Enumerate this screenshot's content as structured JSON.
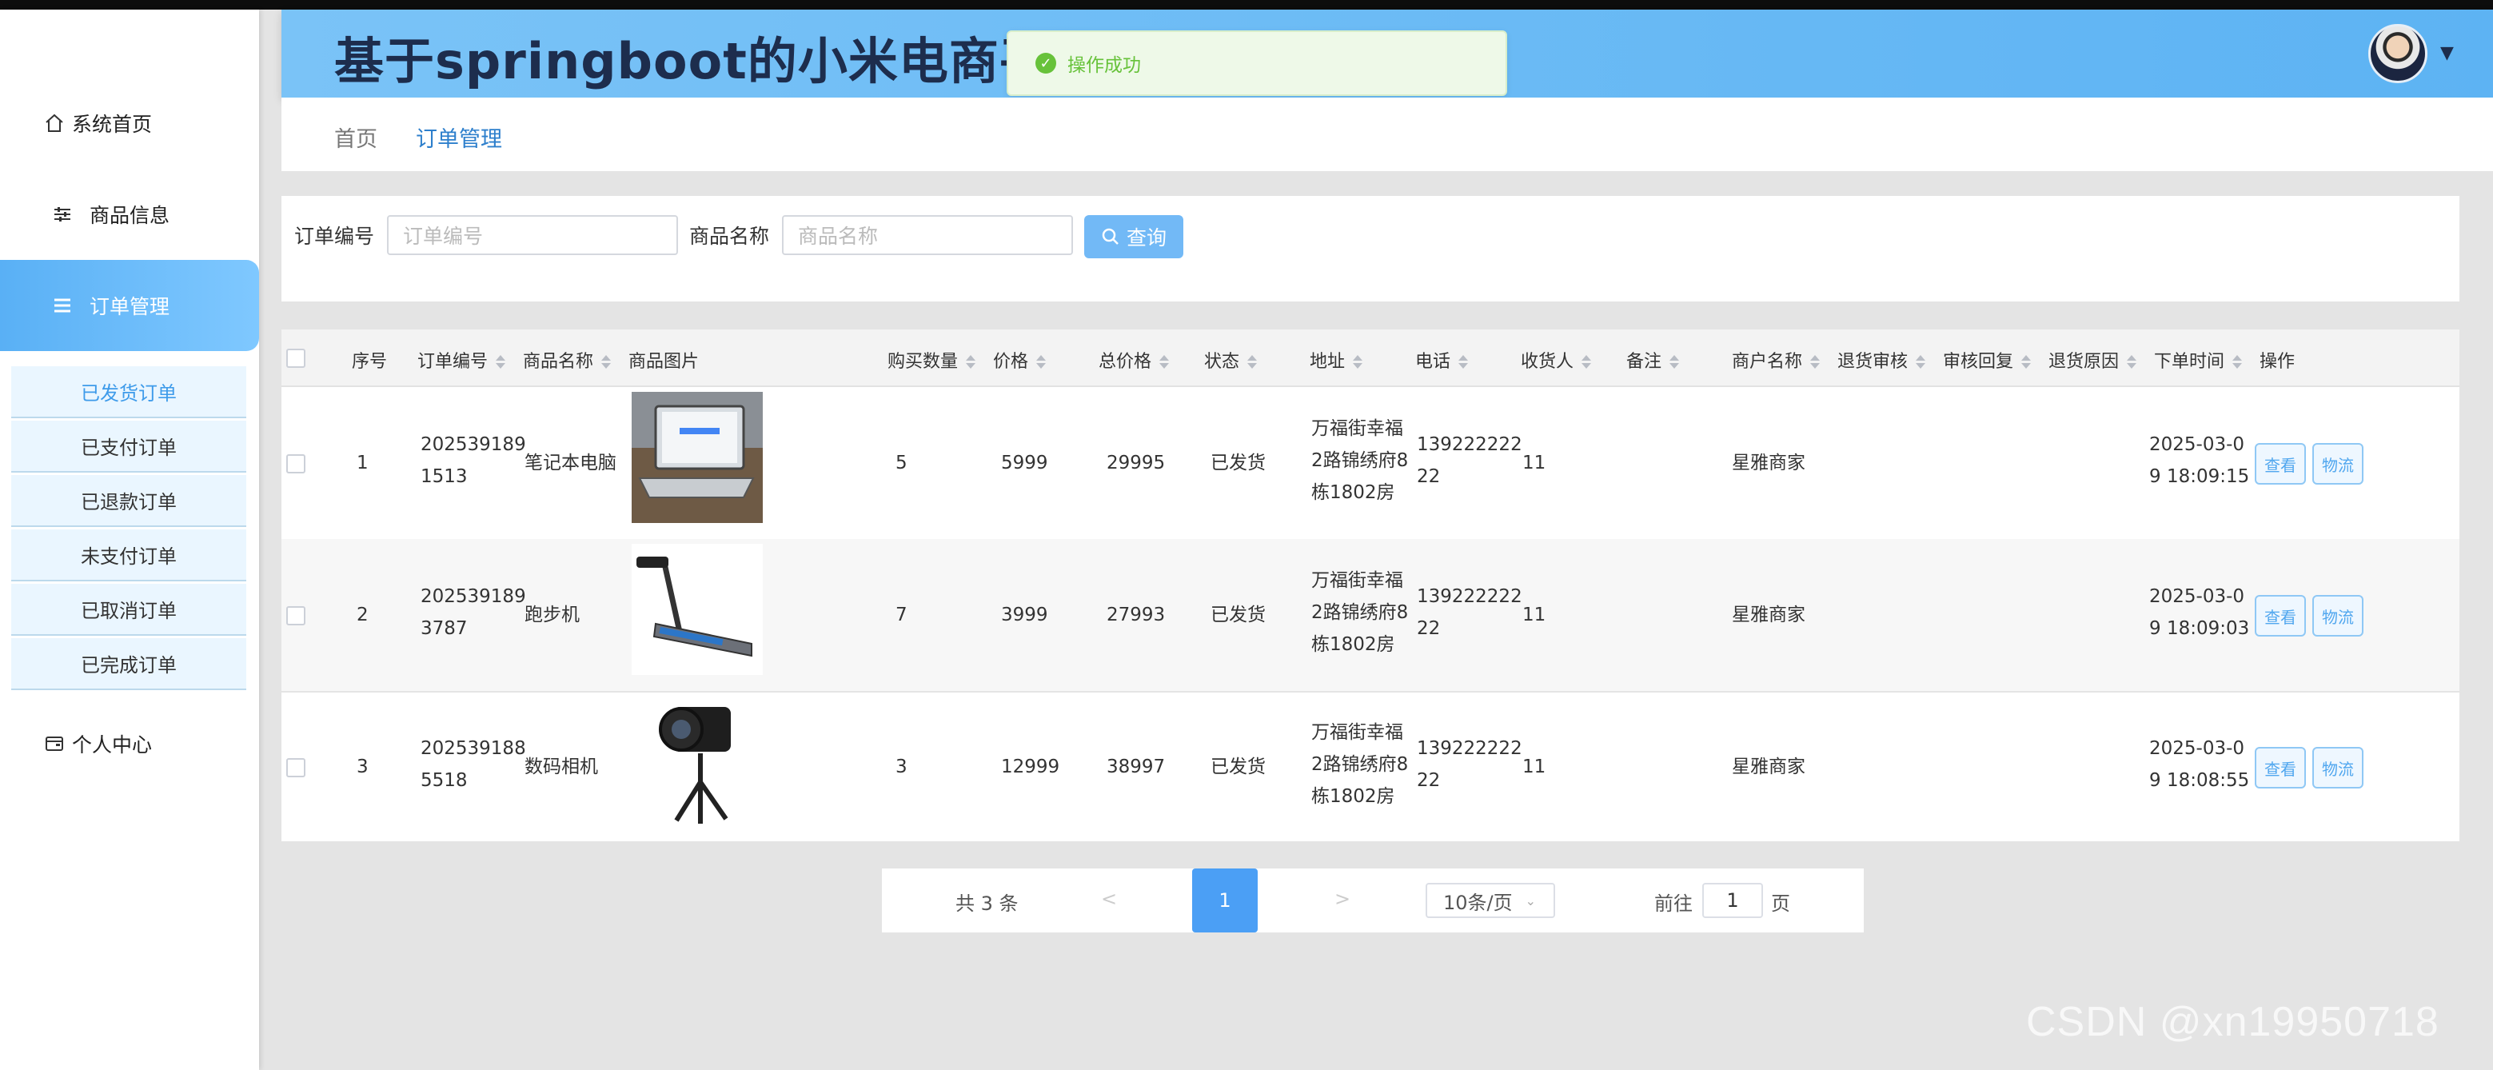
{
  "header": {
    "title": "基于springboot的小米电商平台系统设计与实现"
  },
  "toast": {
    "message": "操作成功"
  },
  "sidebar": {
    "items": [
      {
        "label": "系统首页",
        "icon": "home-icon"
      },
      {
        "label": "商品信息",
        "icon": "sliders-icon"
      },
      {
        "label": "订单管理",
        "icon": "list-icon"
      },
      {
        "label": "个人中心",
        "icon": "wallet-icon"
      }
    ],
    "sub_items": [
      "已发货订单",
      "已支付订单",
      "已退款订单",
      "未支付订单",
      "已取消订单",
      "已完成订单"
    ]
  },
  "breadcrumb": {
    "home": "首页",
    "current": "订单管理"
  },
  "search": {
    "order_no_label": "订单编号",
    "order_no_placeholder": "订单编号",
    "product_label": "商品名称",
    "product_placeholder": "商品名称",
    "query_label": "查询"
  },
  "table": {
    "headers": [
      "序号",
      "订单编号",
      "商品名称",
      "商品图片",
      "购买数量",
      "价格",
      "总价格",
      "状态",
      "地址",
      "电话",
      "收货人",
      "备注",
      "商户名称",
      "退货审核",
      "审核回复",
      "退货原因",
      "下单时间",
      "操作"
    ],
    "rows": [
      {
        "index": "1",
        "order_no": [
          "202539189",
          "1513"
        ],
        "product": "笔记本电脑",
        "image": "laptop",
        "qty": "5",
        "price": "5999",
        "total": "29995",
        "status": "已发货",
        "address": [
          "万福街幸福",
          "2路锦绣府8",
          "栋1802房"
        ],
        "phone": [
          "139222222",
          "22"
        ],
        "receiver": "11",
        "note": "",
        "merchant": "星雅商家",
        "time": [
          "2025-03-0",
          "9 18:09:15"
        ]
      },
      {
        "index": "2",
        "order_no": [
          "202539189",
          "3787"
        ],
        "product": "跑步机",
        "image": "treadmill",
        "qty": "7",
        "price": "3999",
        "total": "27993",
        "status": "已发货",
        "address": [
          "万福街幸福",
          "2路锦绣府8",
          "栋1802房"
        ],
        "phone": [
          "139222222",
          "22"
        ],
        "receiver": "11",
        "note": "",
        "merchant": "星雅商家",
        "time": [
          "2025-03-0",
          "9 18:09:03"
        ]
      },
      {
        "index": "3",
        "order_no": [
          "202539188",
          "5518"
        ],
        "product": "数码相机",
        "image": "camera",
        "qty": "3",
        "price": "12999",
        "total": "38997",
        "status": "已发货",
        "address": [
          "万福街幸福",
          "2路锦绣府8",
          "栋1802房"
        ],
        "phone": [
          "139222222",
          "22"
        ],
        "receiver": "11",
        "note": "",
        "merchant": "星雅商家",
        "time": [
          "2025-03-0",
          "9 18:08:55"
        ]
      }
    ],
    "view_label": "查看",
    "logistics_label": "物流"
  },
  "pagination": {
    "total": "共 3 条",
    "prev": "<",
    "next": ">",
    "current": "1",
    "page_size": "10条/页",
    "goto_label": "前往",
    "goto_value": "1",
    "page_label": "页"
  },
  "watermark": "CSDN @xn19950718",
  "colors": {
    "accent": "#5db3f3",
    "success": "#67c23a",
    "primary": "#4b9ff5"
  }
}
